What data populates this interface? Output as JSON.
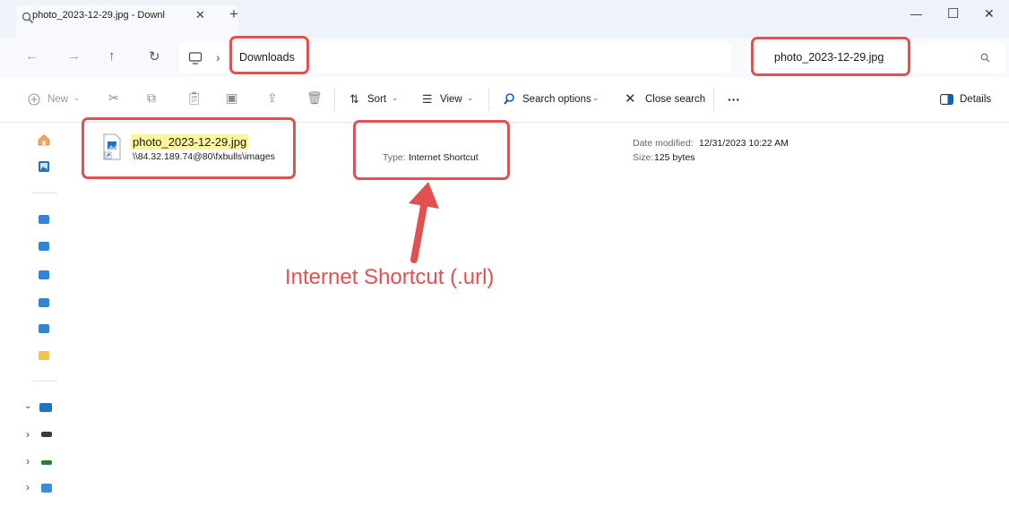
{
  "tab": {
    "title": "photo_2023-12-29.jpg - Downl",
    "close": "✕",
    "new": "+"
  },
  "window": {
    "minimize": "—",
    "maximize": "☐",
    "close": "✕"
  },
  "nav": {
    "back": "←",
    "forward": "→",
    "up": "↑",
    "refresh": "↻",
    "chevron": "›"
  },
  "address": {
    "current": "Downloads"
  },
  "search": {
    "value": "photo_2023-12-29.jpg"
  },
  "toolbar": {
    "new_label": "New",
    "sort_label": "Sort",
    "view_label": "View",
    "search_options_label": "Search options",
    "close_search_label": "Close search",
    "more_label": "···",
    "details_label": "Details"
  },
  "file": {
    "name": "photo_2023-12-29.jpg",
    "path": "\\\\84.32.189.74@80\\fxbulls\\images",
    "type_label": "Type:",
    "type_value": "Internet Shortcut",
    "date_label": "Date modified:",
    "date_value": "12/31/2023 10:22 AM",
    "size_label": "Size:",
    "size_value": "125 bytes"
  },
  "annotation": {
    "text": "Internet Shortcut (.url)"
  },
  "colors": {
    "highlight": "#e35050",
    "accent": "#0067c0",
    "search_highlight": "#fef59e"
  }
}
